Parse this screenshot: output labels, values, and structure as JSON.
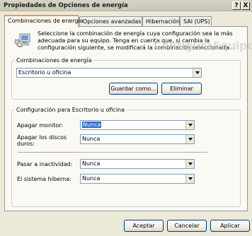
{
  "window": {
    "title": "Propiedades de Opciones de energía",
    "help_button": "?",
    "close_button": "X"
  },
  "tabs": [
    {
      "label": "Combinaciones de energía",
      "active": true
    },
    {
      "label": "Opciones avanzadas",
      "active": false
    },
    {
      "label": "Hibernación",
      "active": false
    },
    {
      "label": "SAI (UPS)",
      "active": false
    }
  ],
  "intro": {
    "text": "Seleccione la combinación de energía cuya configuración sea la más adecuada para su equipo. Tenga en cuenta que, si cambia la configuración siguiente, se modificará la combinación seleccionada."
  },
  "watermark": "ConfiguraEquipos",
  "schemes": {
    "legend": "Combinaciones de energía",
    "selected": "Escritorio u oficina",
    "save_as_label": "Guardar como...",
    "delete_label": "Eliminar"
  },
  "settings": {
    "legend": "Configuración para Escritorio u oficina",
    "rows": [
      {
        "label": "Apagar monitor:",
        "value": "Nunca"
      },
      {
        "label": "Apagar los discos duros:",
        "value": "Nunca"
      },
      {
        "label": "Pasar a inactividad:",
        "value": "Nunca"
      },
      {
        "label": "El sistema hiberna:",
        "value": "Nunca"
      }
    ]
  },
  "footer": {
    "ok_label": "Aceptar",
    "cancel_label": "Cancelar",
    "apply_label": "Aplicar"
  },
  "icons": {
    "intro": "power-plug-computer-icon"
  }
}
